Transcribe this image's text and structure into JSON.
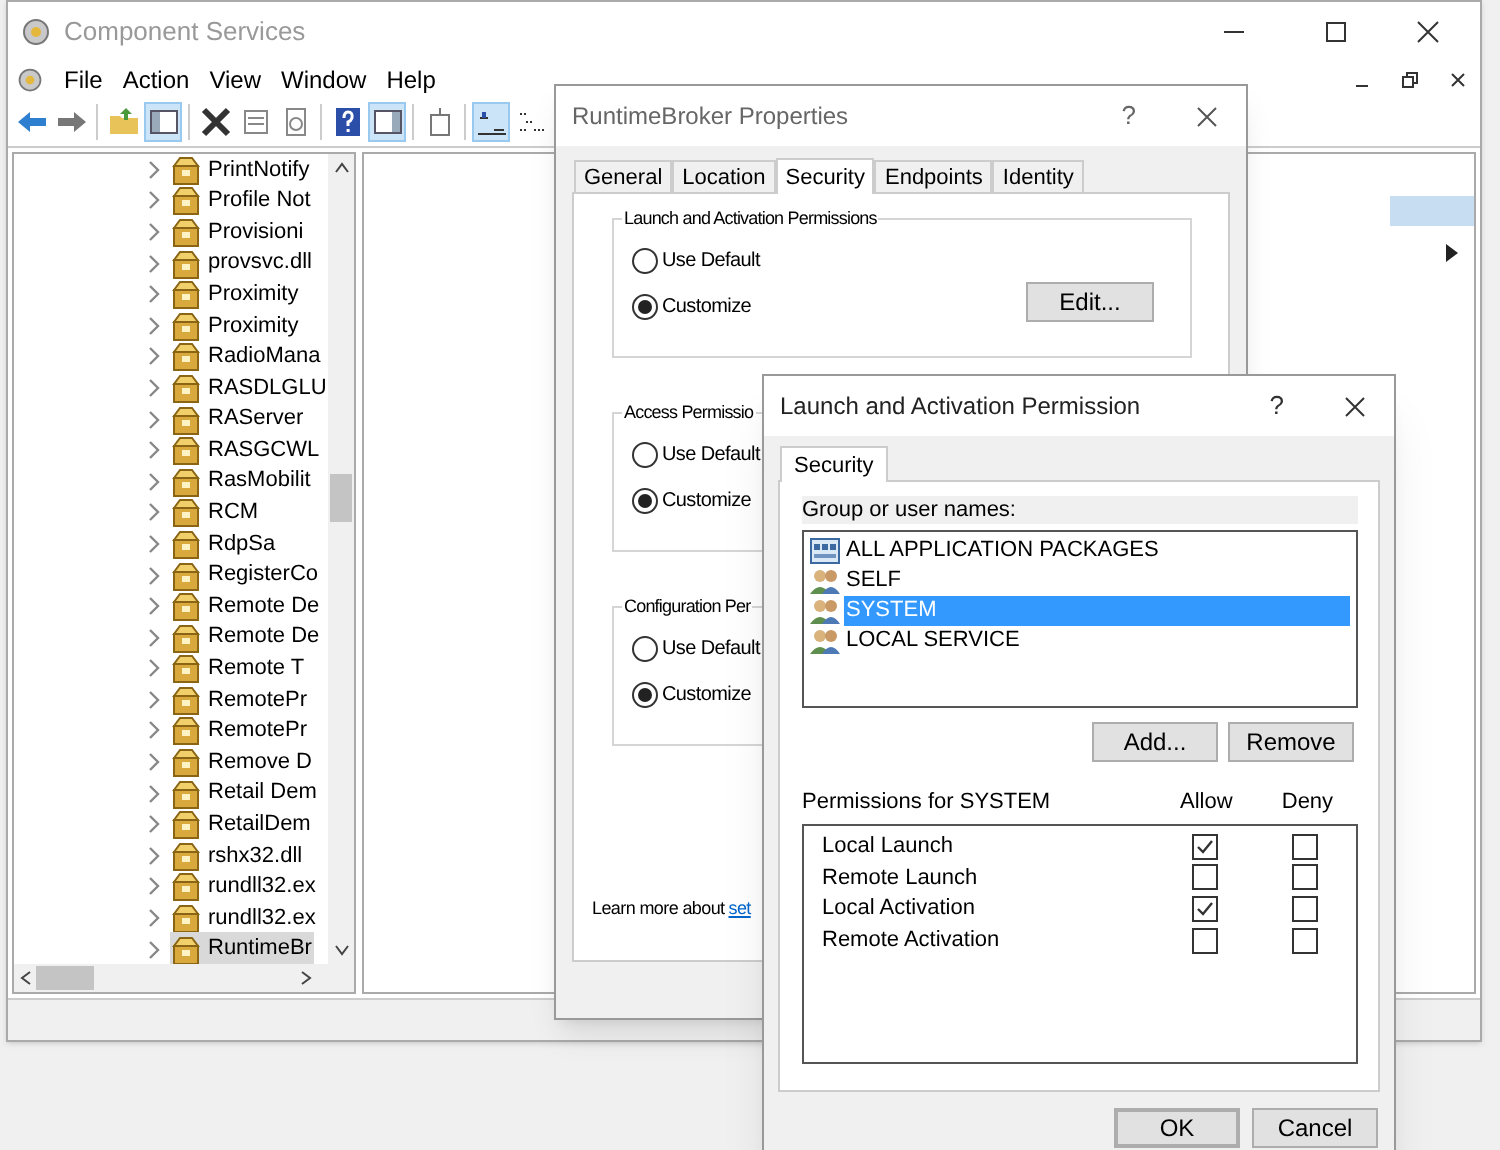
{
  "main_window": {
    "title": "Component Services",
    "menu": [
      "File",
      "Action",
      "View",
      "Window",
      "Help"
    ],
    "tree": {
      "items": [
        {
          "label": "PrintNotify",
          "selected": false
        },
        {
          "label": "Profile Not",
          "selected": false
        },
        {
          "label": "Provisioni",
          "selected": false
        },
        {
          "label": "provsvc.dll",
          "selected": false
        },
        {
          "label": "Proximity",
          "selected": false
        },
        {
          "label": "Proximity",
          "selected": false
        },
        {
          "label": "RadioMana",
          "selected": false
        },
        {
          "label": "RASDLGLU",
          "selected": false
        },
        {
          "label": "RAServer",
          "selected": false
        },
        {
          "label": "RASGCWL",
          "selected": false
        },
        {
          "label": "RasMobilit",
          "selected": false
        },
        {
          "label": "RCM",
          "selected": false
        },
        {
          "label": "RdpSa",
          "selected": false
        },
        {
          "label": "RegisterCo",
          "selected": false
        },
        {
          "label": "Remote De",
          "selected": false
        },
        {
          "label": "Remote De",
          "selected": false
        },
        {
          "label": "Remote T",
          "selected": false
        },
        {
          "label": "RemotePr",
          "selected": false
        },
        {
          "label": "RemotePr",
          "selected": false
        },
        {
          "label": "Remove D",
          "selected": false
        },
        {
          "label": "Retail Dem",
          "selected": false
        },
        {
          "label": "RetailDem",
          "selected": false
        },
        {
          "label": "rshx32.dll",
          "selected": false
        },
        {
          "label": "rundll32.ex",
          "selected": false
        },
        {
          "label": "rundll32.ex",
          "selected": false
        },
        {
          "label": "RuntimeBr",
          "selected": true
        }
      ]
    }
  },
  "properties_dialog": {
    "title": "RuntimeBroker Properties",
    "help_glyph": "?",
    "tabs": [
      {
        "label": "General",
        "selected": false
      },
      {
        "label": "Location",
        "selected": false
      },
      {
        "label": "Security",
        "selected": true
      },
      {
        "label": "Endpoints",
        "selected": false
      },
      {
        "label": "Identity",
        "selected": false
      }
    ],
    "groups": [
      {
        "title": "Launch and Activation Permissions",
        "options": [
          {
            "label": "Use Default",
            "selected": false
          },
          {
            "label": "Customize",
            "selected": true
          }
        ],
        "button": "Edit..."
      },
      {
        "title": "Access Permissio",
        "options": [
          {
            "label": "Use Default",
            "selected": false
          },
          {
            "label": "Customize",
            "selected": true
          }
        ]
      },
      {
        "title": "Configuration Per",
        "options": [
          {
            "label": "Use Default",
            "selected": false
          },
          {
            "label": "Customize",
            "selected": true
          }
        ]
      }
    ],
    "learn_more": {
      "text": "Learn more about",
      "link": "set"
    }
  },
  "permission_dialog": {
    "title": "Launch and Activation Permission",
    "help_glyph": "?",
    "tabs": [
      {
        "label": "Security",
        "selected": true
      }
    ],
    "group_label": "Group or user names:",
    "users": [
      {
        "name": "ALL APPLICATION PACKAGES",
        "kind": "package",
        "selected": false
      },
      {
        "name": "SELF",
        "kind": "group",
        "selected": false
      },
      {
        "name": "SYSTEM",
        "kind": "group",
        "selected": true
      },
      {
        "name": "LOCAL SERVICE",
        "kind": "group",
        "selected": false
      }
    ],
    "user_buttons": [
      "Add...",
      "Remove"
    ],
    "permissions_label": "Permissions for SYSTEM",
    "columns": [
      "Allow",
      "Deny"
    ],
    "permissions": [
      {
        "name": "Local Launch",
        "allow": true,
        "deny": false
      },
      {
        "name": "Remote Launch",
        "allow": false,
        "deny": false
      },
      {
        "name": "Local Activation",
        "allow": true,
        "deny": false
      },
      {
        "name": "Remote Activation",
        "allow": false,
        "deny": false
      }
    ],
    "buttons": [
      "OK",
      "Cancel"
    ]
  }
}
